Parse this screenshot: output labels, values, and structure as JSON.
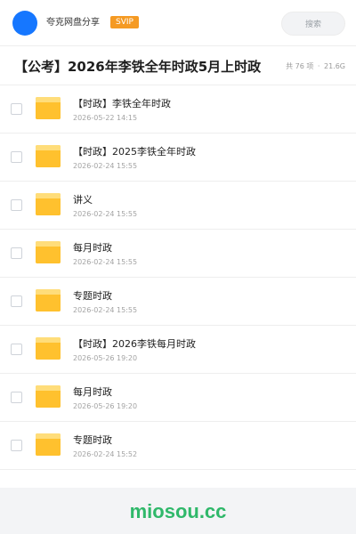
{
  "header": {
    "user_name": "夸克网盘分享",
    "badge": "SVIP",
    "search_placeholder": "搜索"
  },
  "share": {
    "title": "【公考】2026年李铁全年时政5月上时政",
    "count_text": "共 76 项",
    "separator": "·",
    "size_text": "21.6G"
  },
  "files": [
    {
      "name": "【时政】李铁全年时政",
      "time": "2026-05-22 14:15"
    },
    {
      "name": "【时政】2025李铁全年时政",
      "time": "2026-02-24 15:55"
    },
    {
      "name": "讲义",
      "time": "2026-02-24 15:55"
    },
    {
      "name": "每月时政",
      "time": "2026-02-24 15:55"
    },
    {
      "name": "专题时政",
      "time": "2026-02-24 15:55"
    },
    {
      "name": "【时政】2026李铁每月时政",
      "time": "2026-05-26 19:20"
    },
    {
      "name": "每月时政",
      "time": "2026-05-26 19:20"
    },
    {
      "name": "专题时政",
      "time": "2026-02-24 15:52"
    }
  ],
  "footer": {
    "brand": "miosou.cc"
  },
  "colors": {
    "accent": "#1677ff",
    "badge": "#f59a23",
    "folder": "#ffc12e",
    "brand": "#2fb86a"
  }
}
